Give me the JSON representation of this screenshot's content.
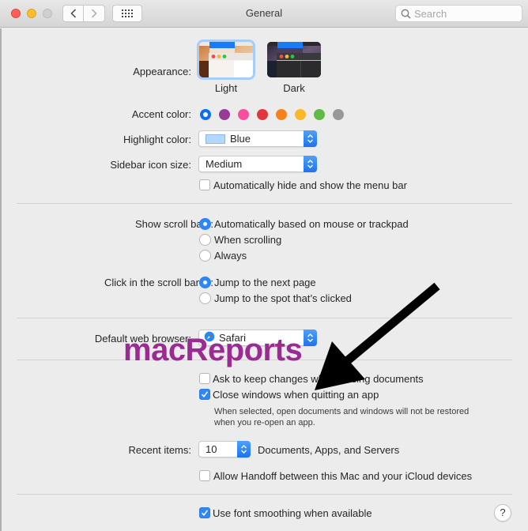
{
  "window": {
    "title": "General",
    "search_placeholder": "Search"
  },
  "appearance": {
    "label": "Appearance:",
    "options": [
      {
        "name": "Light",
        "selected": true
      },
      {
        "name": "Dark",
        "selected": false
      }
    ]
  },
  "accent": {
    "label": "Accent color:",
    "colors": [
      {
        "name": "Blue",
        "hex": "#0a6ff0",
        "selected": true
      },
      {
        "name": "Purple",
        "hex": "#953d96",
        "selected": false
      },
      {
        "name": "Pink",
        "hex": "#f74f9e",
        "selected": false
      },
      {
        "name": "Red",
        "hex": "#e0383e",
        "selected": false
      },
      {
        "name": "Orange",
        "hex": "#f7821b",
        "selected": false
      },
      {
        "name": "Yellow",
        "hex": "#fcb827",
        "selected": false
      },
      {
        "name": "Green",
        "hex": "#62ba46",
        "selected": false
      },
      {
        "name": "Graphite",
        "hex": "#989898",
        "selected": false
      }
    ]
  },
  "highlight": {
    "label": "Highlight color:",
    "value": "Blue",
    "swatch": "#b3d7ff"
  },
  "sidebar_icon": {
    "label": "Sidebar icon size:",
    "value": "Medium"
  },
  "menubar": {
    "label": "Automatically hide and show the menu bar",
    "checked": false
  },
  "scroll_bars": {
    "label": "Show scroll bars:",
    "options": [
      {
        "label": "Automatically based on mouse or trackpad",
        "selected": true
      },
      {
        "label": "When scrolling",
        "selected": false
      },
      {
        "label": "Always",
        "selected": false
      }
    ]
  },
  "click_scroll": {
    "label": "Click in the scroll bar to:",
    "options": [
      {
        "label": "Jump to the next page",
        "selected": true
      },
      {
        "label": "Jump to the spot that’s clicked",
        "selected": false
      }
    ]
  },
  "browser": {
    "label": "Default web browser:",
    "value": "Safari"
  },
  "documents": {
    "ask_keep": {
      "label": "Ask to keep changes when closing documents",
      "checked": false
    },
    "close_windows": {
      "label": "Close windows when quitting an app",
      "checked": true
    },
    "note_line1": "When selected, open documents and windows will not be restored",
    "note_line2": "when you re-open an app."
  },
  "recent": {
    "label": "Recent items:",
    "value": "10",
    "suffix": "Documents, Apps, and Servers"
  },
  "handoff": {
    "label": "Allow Handoff between this Mac and your iCloud devices",
    "checked": false
  },
  "font_smoothing": {
    "label": "Use font smoothing when available",
    "checked": true
  },
  "help_label": "?",
  "watermark": "macReports"
}
